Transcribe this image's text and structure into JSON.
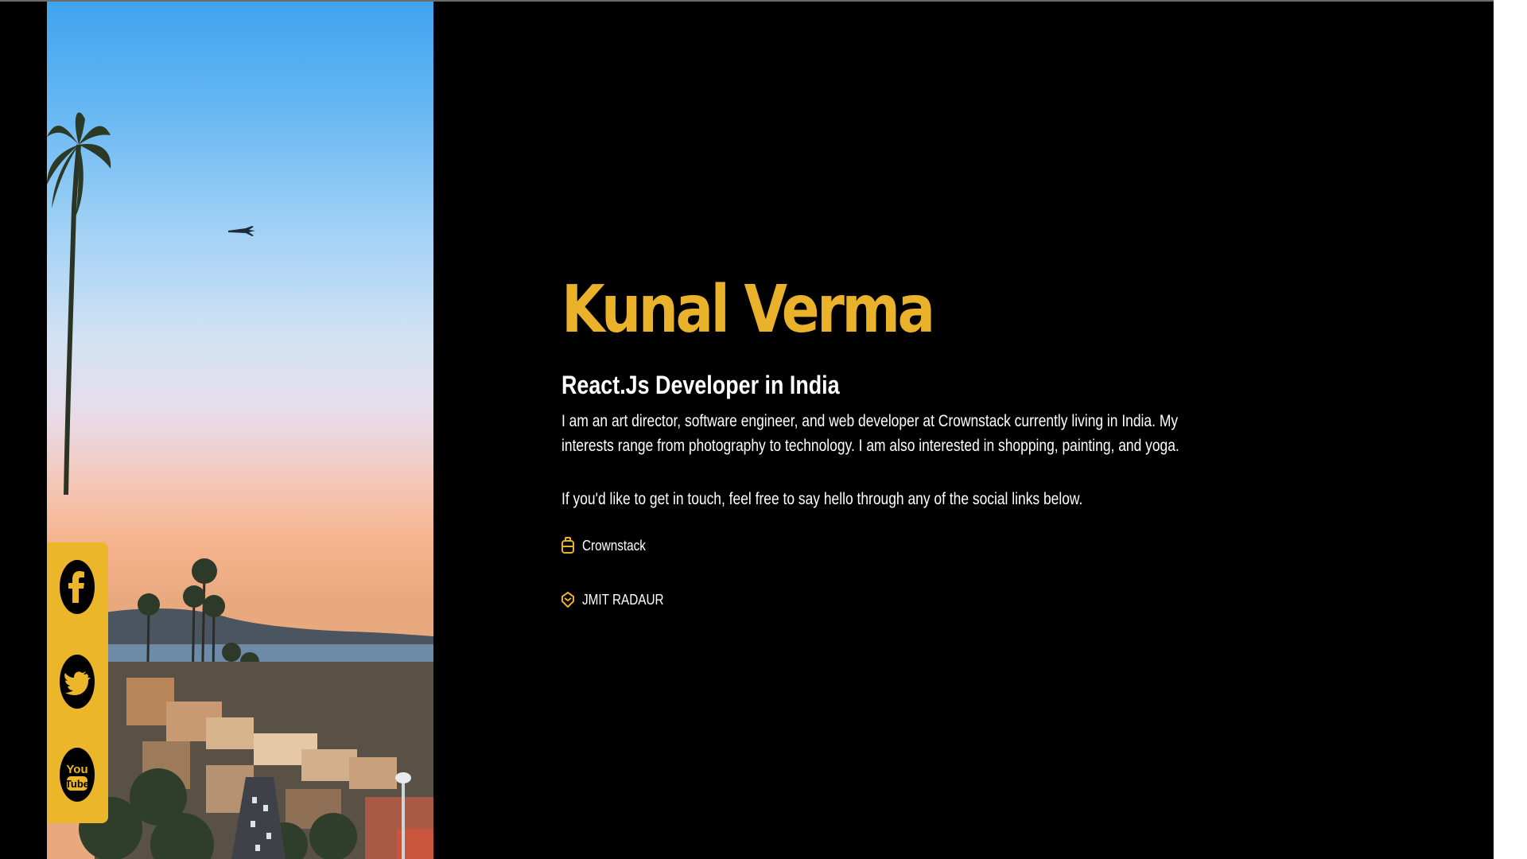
{
  "profile": {
    "name": "Kunal Verma",
    "role": "React.Js Developer in India",
    "bio": "I am an art director, software engineer, and web developer at Crownstack currently living in India. My interests range from photography to technology. I am also interested in shopping, painting, and yoga.",
    "contact_note": "If you'd like to get in touch, feel free to say hello through any of the social links below."
  },
  "details": {
    "work": {
      "icon": "briefcase-icon",
      "label": "Crownstack"
    },
    "education": {
      "icon": "graduation-cap-icon",
      "label": "JMIT RADAUR"
    }
  },
  "social": [
    {
      "name": "facebook",
      "icon": "facebook-icon"
    },
    {
      "name": "twitter",
      "icon": "twitter-icon"
    },
    {
      "name": "youtube",
      "icon": "youtube-icon",
      "label_top": "You",
      "label_bottom": "Tube"
    }
  ],
  "colors": {
    "background": "#000000",
    "accent": "#e9b22a",
    "social_bar": "#ecb62b",
    "text": "#ffffff"
  }
}
